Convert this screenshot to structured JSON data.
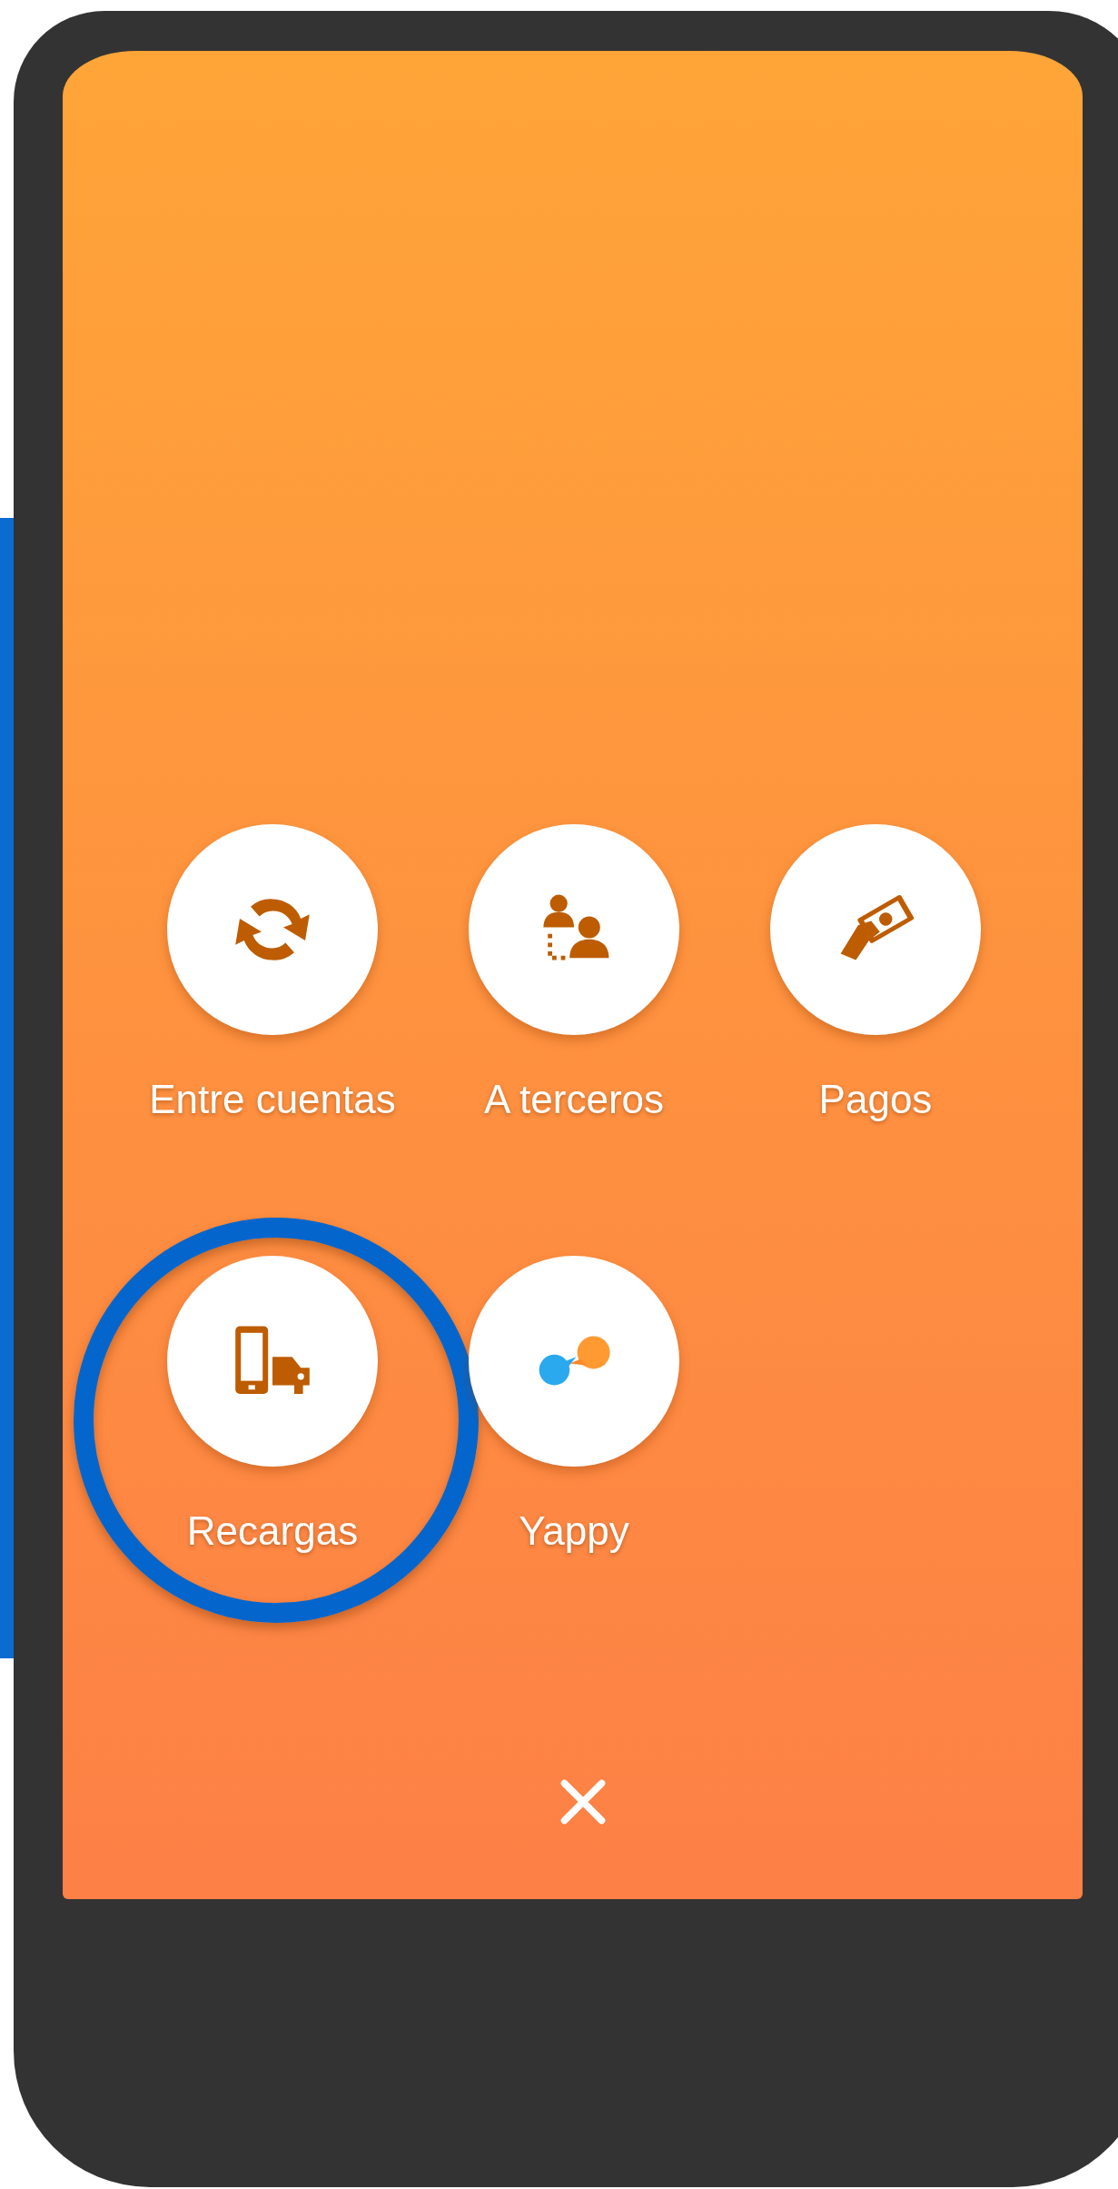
{
  "menu": {
    "items": [
      {
        "kind": "transfer",
        "label": "Entre cuentas",
        "highlighted": false
      },
      {
        "kind": "third-party",
        "label": "A terceros",
        "highlighted": false
      },
      {
        "kind": "payment",
        "label": "Pagos",
        "highlighted": false
      },
      {
        "kind": "topup",
        "label": "Recargas",
        "highlighted": true
      },
      {
        "kind": "yappy",
        "label": "Yappy",
        "highlighted": false
      }
    ]
  }
}
